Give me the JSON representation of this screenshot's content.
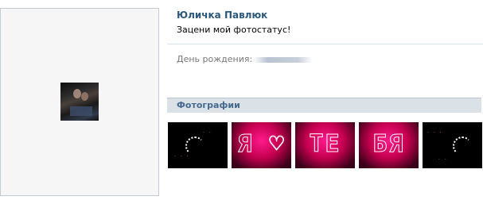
{
  "profile": {
    "name": "Юличка Павлюк",
    "status": "Зацени мой фотостатус!",
    "birthday_label": "День рождения:"
  },
  "photos": {
    "header": "Фотографии",
    "thumbnails": [
      {
        "letters": ""
      },
      {
        "letters": "Я ♡"
      },
      {
        "letters": "ТЕ"
      },
      {
        "letters": "БЯ"
      },
      {
        "letters": ""
      }
    ]
  },
  "colors": {
    "name_link": "#2b587a",
    "section_header_bg": "#dae2e8",
    "section_header_text": "#45688e",
    "divider": "#dae1e8"
  },
  "icons": {
    "avatar": "profile-photo"
  }
}
